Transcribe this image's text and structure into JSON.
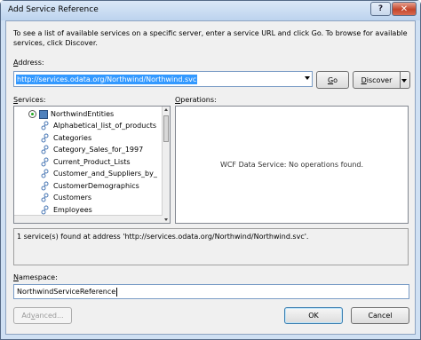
{
  "window": {
    "title": "Add Service Reference",
    "help_label": "?",
    "close_label": "✕"
  },
  "intro": "To see a list of available services on a specific server, enter a service URL and click Go. To browse for available services, click Discover.",
  "address": {
    "label_prefix": "",
    "label_access": "A",
    "label_rest": "ddress:",
    "value": "http://services.odata.org/Northwind/Northwind.svc",
    "go_access": "G",
    "go_rest": "o",
    "discover_access": "D",
    "discover_rest": "iscover"
  },
  "services": {
    "label_access": "S",
    "label_rest": "ervices:",
    "root": "NorthwindEntities",
    "items": [
      "Alphabetical_list_of_products",
      "Categories",
      "Category_Sales_for_1997",
      "Current_Product_Lists",
      "Customer_and_Suppliers_by_",
      "CustomerDemographics",
      "Customers",
      "Employees"
    ]
  },
  "operations": {
    "label_access": "O",
    "label_rest": "perations:",
    "message": "WCF Data Service: No operations found."
  },
  "status": "1 service(s) found at address 'http://services.odata.org/Northwind/Northwind.svc'.",
  "namespace": {
    "label_access": "N",
    "label_rest": "amespace:",
    "value": "NorthwindServiceReference"
  },
  "buttons": {
    "advanced_prefix": "Ad",
    "advanced_access": "v",
    "advanced_rest": "anced...",
    "ok": "OK",
    "cancel": "Cancel"
  },
  "colors": {
    "selection": "#3399ff",
    "title_bar": "#cfe0f3",
    "close_button": "#c4452b"
  },
  "icons": {
    "root": "service-container-icon",
    "entity": "entity-set-icon",
    "expander": "tree-expander-icon"
  }
}
